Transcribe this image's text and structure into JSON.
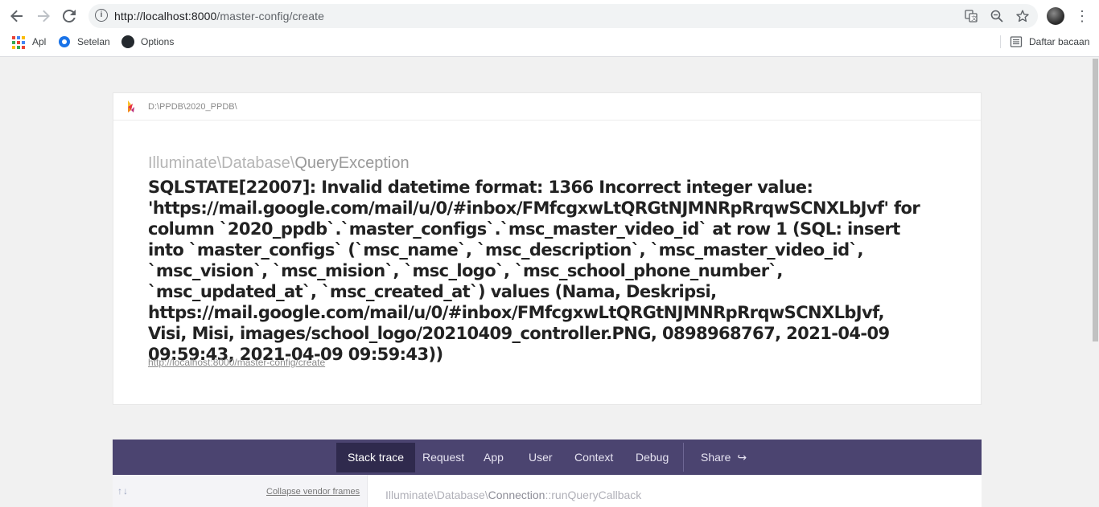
{
  "browser": {
    "url_host": "http://localhost:8000",
    "url_path": "/master-config/create",
    "bookmarks": [
      {
        "label": "Apl",
        "icon": "apps-grid-icon"
      },
      {
        "label": "Setelan",
        "icon": "gear-icon"
      },
      {
        "label": "Options",
        "icon": "github-icon"
      }
    ],
    "reading_list": "Daftar bacaan"
  },
  "error": {
    "project_path": "D:\\PPDB\\2020_PPDB\\",
    "exception_namespace": "Illuminate\\Database\\",
    "exception_class": "QueryException",
    "message": "SQLSTATE[22007]: Invalid datetime format: 1366 Incorrect integer value: 'https://mail.google.com/mail/u/0/#inbox/FMfcgxwLtQRGtNJMNRpRrqwSCNXLbJvf' for column `2020_ppdb`.`master_configs`.`msc_master_video_id` at row 1 (SQL: insert into `master_configs` (`msc_name`, `msc_description`, `msc_master_video_id`, `msc_vision`, `msc_mision`, `msc_logo`, `msc_school_phone_number`, `msc_updated_at`, `msc_created_at`) values (Nama, Deskripsi, https://mail.google.com/mail/u/0/#inbox/FMfcgxwLtQRGtNJMNRpRrqwSCNXLbJvf, Visi, Misi, images/school_logo/20210409_controller.PNG, 0898968767, 2021-04-09 09:59:43, 2021-04-09 09:59:43))",
    "request_url": "http://localhost:8000/master-config/create"
  },
  "tabs": {
    "stack_trace": "Stack trace",
    "request": "Request",
    "app": "App",
    "user": "User",
    "context": "Context",
    "debug": "Debug",
    "share": "Share"
  },
  "trace": {
    "collapse_label": "Collapse vendor frames",
    "frame_namespace": "Illuminate\\Database\\",
    "frame_class": "Connection",
    "frame_method": "::runQueryCallback"
  }
}
